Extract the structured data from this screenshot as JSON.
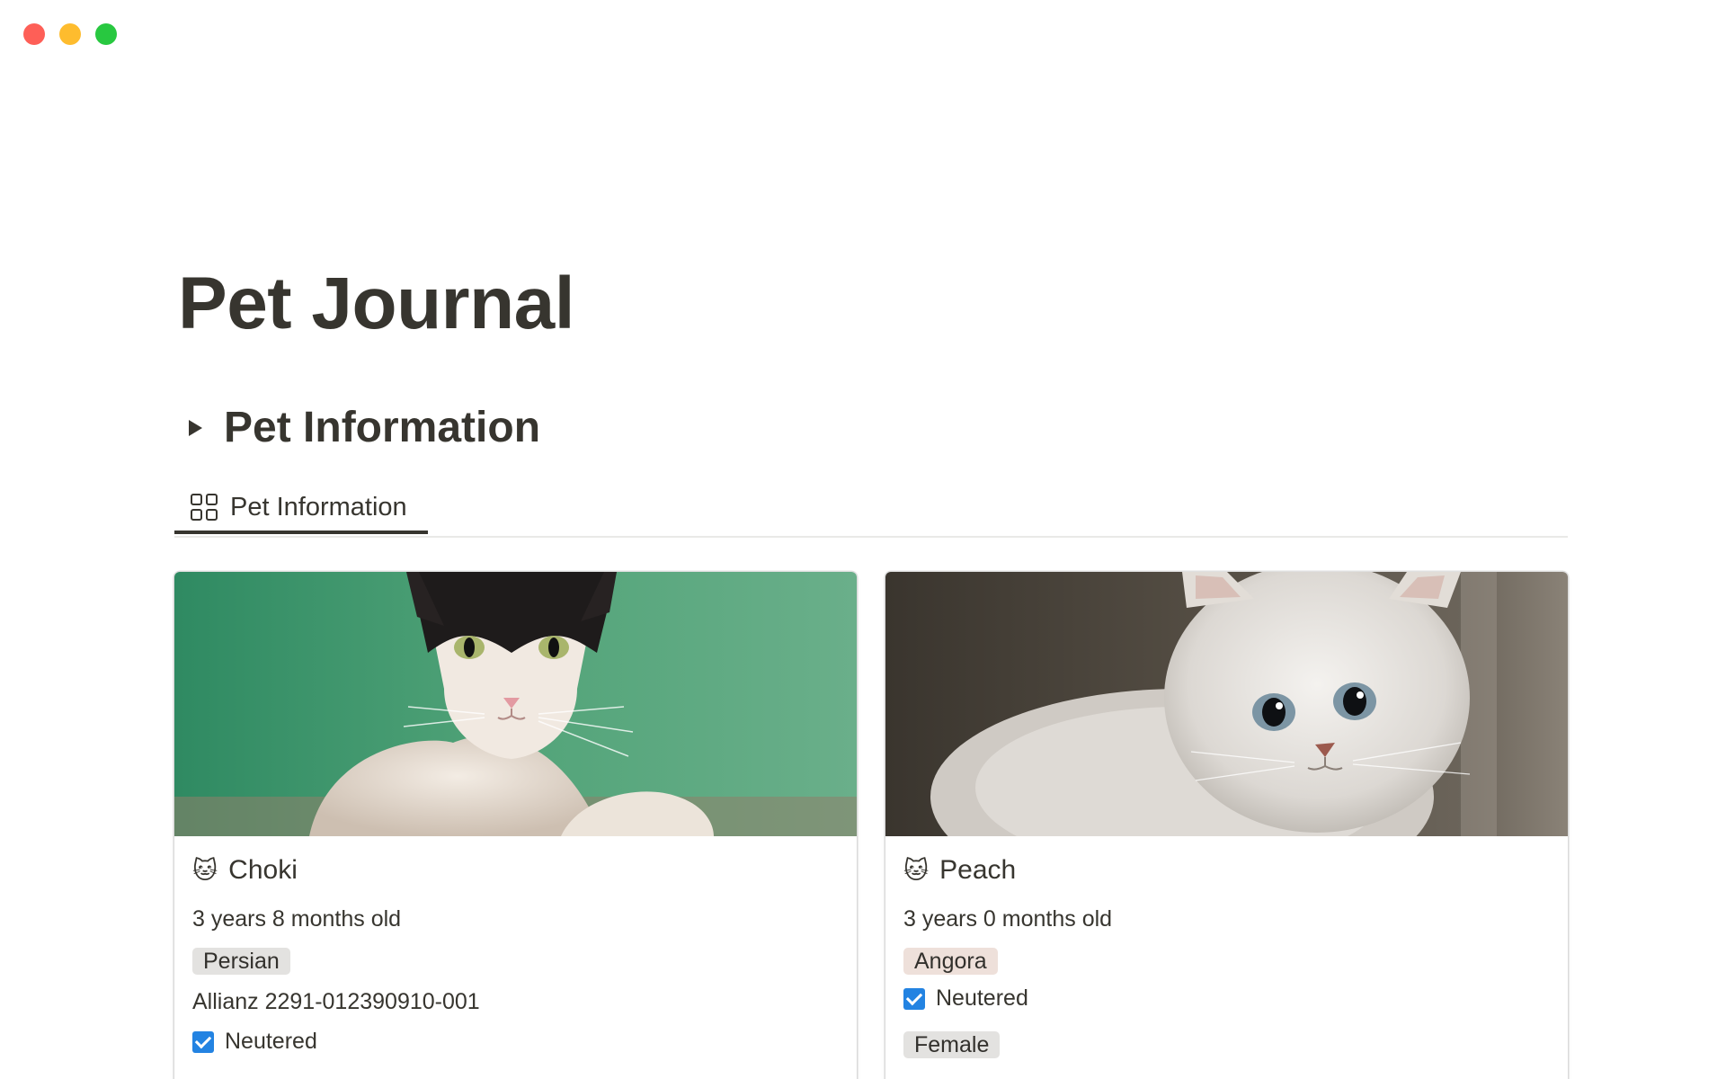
{
  "window": {
    "controls": [
      "close",
      "minimize",
      "zoom"
    ]
  },
  "page": {
    "title": "Pet Journal"
  },
  "toggle_heading": {
    "label": "Pet Information",
    "icon": "triangle-right-icon"
  },
  "view_tab": {
    "label": "Pet Information",
    "icon": "gallery-grid-icon"
  },
  "cards": [
    {
      "name": "Choki",
      "icon": "cat-face-icon",
      "age": "3 years 8 months old",
      "breed": "Persian",
      "breed_color": "gray",
      "insurance": "Allianz 2291-012390910-001",
      "neutered_label": "Neutered",
      "neutered": true,
      "cover": "black and white cat on green background"
    },
    {
      "name": "Peach",
      "icon": "cat-face-icon",
      "age": "3 years 0 months old",
      "breed": "Angora",
      "breed_color": "brown",
      "neutered_label": "Neutered",
      "neutered": true,
      "sex": "Female",
      "cover": "white fluffy kitten"
    }
  ],
  "colors": {
    "text": "#37352f",
    "checkbox": "#2383e2",
    "tag_gray": "#e3e2e0",
    "tag_brown": "#eee0da"
  }
}
